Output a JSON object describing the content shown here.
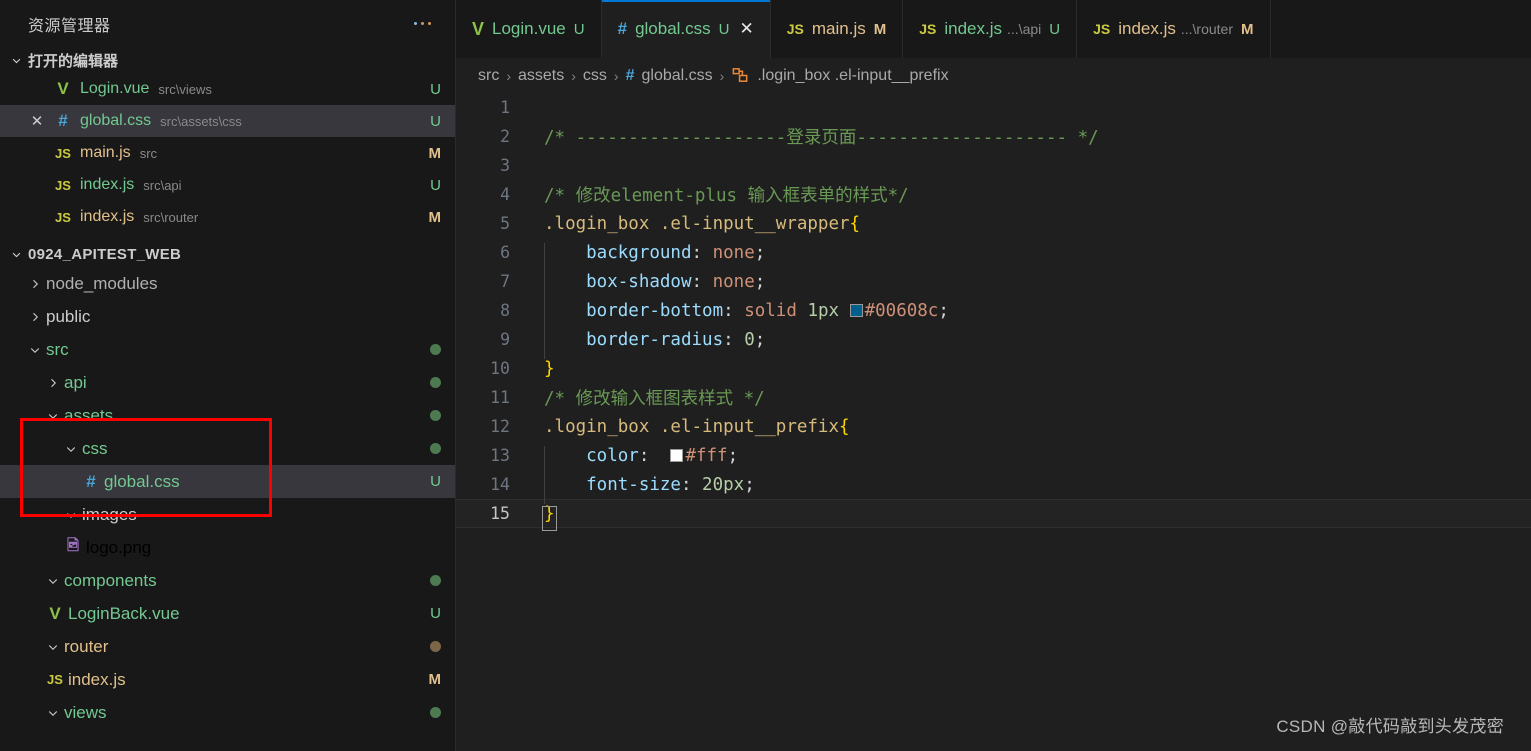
{
  "sidebar": {
    "title": "资源管理器",
    "more_icon": "ellipsis-icon",
    "open_editors": {
      "label": "打开的编辑器",
      "items": [
        {
          "icon": "vue-file-icon",
          "name": "Login.vue",
          "path": "src\\views",
          "badge": "U",
          "selected": false,
          "closable": false
        },
        {
          "icon": "css-file-icon",
          "name": "global.css",
          "path": "src\\assets\\css",
          "badge": "U",
          "selected": true,
          "closable": true
        },
        {
          "icon": "js-file-icon",
          "name": "main.js",
          "path": "src",
          "badge": "M",
          "selected": false,
          "closable": false
        },
        {
          "icon": "js-file-icon",
          "name": "index.js",
          "path": "src\\api",
          "badge": "U",
          "selected": false,
          "closable": false
        },
        {
          "icon": "js-file-icon",
          "name": "index.js",
          "path": "src\\router",
          "badge": "M",
          "selected": false,
          "closable": false
        }
      ]
    },
    "project": {
      "name": "0924_APITEST_WEB",
      "tree": [
        {
          "label": "node_modules",
          "type": "folder",
          "expanded": false,
          "indent": 1,
          "color": "dim",
          "badge": "",
          "dot": ""
        },
        {
          "label": "public",
          "type": "folder",
          "expanded": false,
          "indent": 1,
          "color": "gray",
          "badge": "",
          "dot": ""
        },
        {
          "label": "src",
          "type": "folder",
          "expanded": true,
          "indent": 1,
          "color": "green",
          "badge": "",
          "dot": "green"
        },
        {
          "label": "api",
          "type": "folder",
          "expanded": false,
          "indent": 2,
          "color": "green",
          "badge": "",
          "dot": "green"
        },
        {
          "label": "assets",
          "type": "folder",
          "expanded": true,
          "indent": 2,
          "color": "green",
          "badge": "",
          "dot": "green"
        },
        {
          "label": "css",
          "type": "folder",
          "expanded": true,
          "indent": 3,
          "color": "green",
          "badge": "",
          "dot": "green"
        },
        {
          "label": "global.css",
          "type": "css",
          "expanded": null,
          "indent": 4,
          "color": "green",
          "badge": "U",
          "dot": "",
          "selected": true
        },
        {
          "label": "images",
          "type": "folder",
          "expanded": true,
          "indent": 3,
          "color": "gray",
          "badge": "",
          "dot": ""
        },
        {
          "label": "logo.png",
          "type": "png",
          "expanded": null,
          "indent": 3,
          "color": "white",
          "badge": "",
          "dot": ""
        },
        {
          "label": "components",
          "type": "folder",
          "expanded": true,
          "indent": 2,
          "color": "green",
          "badge": "",
          "dot": "green"
        },
        {
          "label": "LoginBack.vue",
          "type": "vue",
          "expanded": null,
          "indent": 2,
          "color": "green",
          "badge": "U",
          "dot": ""
        },
        {
          "label": "router",
          "type": "folder",
          "expanded": true,
          "indent": 2,
          "color": "orange",
          "badge": "",
          "dot": "tan"
        },
        {
          "label": "index.js",
          "type": "js",
          "expanded": null,
          "indent": 2,
          "color": "orange",
          "badge": "M",
          "dot": ""
        },
        {
          "label": "views",
          "type": "folder",
          "expanded": true,
          "indent": 2,
          "color": "green",
          "badge": "",
          "dot": "green"
        }
      ]
    },
    "annotation": {
      "name": "red-highlight-box",
      "color": "#fe0000"
    }
  },
  "tabs": [
    {
      "icon": "vue-file-icon",
      "label": "Login.vue",
      "dir": "",
      "badge": "U",
      "active": false,
      "closable": false
    },
    {
      "icon": "css-file-icon",
      "label": "global.css",
      "dir": "",
      "badge": "U",
      "active": true,
      "closable": true
    },
    {
      "icon": "js-file-icon",
      "label": "main.js",
      "dir": "",
      "badge": "M",
      "active": false,
      "closable": false
    },
    {
      "icon": "js-file-icon",
      "label": "index.js",
      "dir": "...\\api",
      "badge": "U",
      "active": false,
      "closable": false
    },
    {
      "icon": "js-file-icon",
      "label": "index.js",
      "dir": "...\\router",
      "badge": "M",
      "active": false,
      "closable": false
    }
  ],
  "breadcrumb": {
    "items": [
      "src",
      "assets",
      "css",
      "global.css",
      ".login_box .el-input__prefix"
    ],
    "separator": "›",
    "file_icon": "#",
    "symbol_icon": "css-rule-symbol-icon"
  },
  "code": {
    "language": "css",
    "lines": [
      {
        "n": "1",
        "segments": []
      },
      {
        "n": "2",
        "segments": [
          {
            "t": "comment",
            "v": "/* --------------------登录页面-------------------- */"
          }
        ]
      },
      {
        "n": "3",
        "segments": []
      },
      {
        "n": "4",
        "segments": [
          {
            "t": "comment",
            "v": "/* 修改element-plus 输入框表单的样式*/"
          }
        ]
      },
      {
        "n": "5",
        "segments": [
          {
            "t": "sel",
            "v": ".login_box .el-input__wrapper"
          },
          {
            "t": "brace",
            "v": "{"
          }
        ]
      },
      {
        "n": "6",
        "segments": [
          {
            "t": "prop",
            "v": "    background"
          },
          {
            "t": "punct",
            "v": ": "
          },
          {
            "t": "val",
            "v": "none"
          },
          {
            "t": "punct",
            "v": ";"
          }
        ]
      },
      {
        "n": "7",
        "segments": [
          {
            "t": "prop",
            "v": "    box-shadow"
          },
          {
            "t": "punct",
            "v": ": "
          },
          {
            "t": "val",
            "v": "none"
          },
          {
            "t": "punct",
            "v": ";"
          }
        ]
      },
      {
        "n": "8",
        "segments": [
          {
            "t": "prop",
            "v": "    border-bottom"
          },
          {
            "t": "punct",
            "v": ": "
          },
          {
            "t": "val",
            "v": "solid"
          },
          {
            "t": "punct",
            "v": " "
          },
          {
            "t": "num",
            "v": "1px"
          },
          {
            "t": "punct",
            "v": " "
          },
          {
            "t": "swatch",
            "v": "#00608c"
          },
          {
            "t": "val",
            "v": "#00608c"
          },
          {
            "t": "punct",
            "v": ";"
          }
        ]
      },
      {
        "n": "9",
        "segments": [
          {
            "t": "prop",
            "v": "    border-radius"
          },
          {
            "t": "punct",
            "v": ": "
          },
          {
            "t": "num",
            "v": "0"
          },
          {
            "t": "punct",
            "v": ";"
          }
        ]
      },
      {
        "n": "10",
        "segments": [
          {
            "t": "brace",
            "v": "}"
          }
        ]
      },
      {
        "n": "11",
        "segments": [
          {
            "t": "comment",
            "v": "/* 修改输入框图表样式 */"
          }
        ]
      },
      {
        "n": "12",
        "segments": [
          {
            "t": "sel",
            "v": ".login_box .el-input__prefix"
          },
          {
            "t": "brace",
            "v": "{"
          }
        ]
      },
      {
        "n": "13",
        "segments": [
          {
            "t": "prop",
            "v": "    color"
          },
          {
            "t": "punct",
            "v": ":  "
          },
          {
            "t": "swatch",
            "v": "#ffffff"
          },
          {
            "t": "val",
            "v": "#fff"
          },
          {
            "t": "punct",
            "v": ";"
          }
        ]
      },
      {
        "n": "14",
        "segments": [
          {
            "t": "prop",
            "v": "    font-size"
          },
          {
            "t": "punct",
            "v": ": "
          },
          {
            "t": "num",
            "v": "20px"
          },
          {
            "t": "punct",
            "v": ";"
          }
        ]
      },
      {
        "n": "15",
        "segments": [
          {
            "t": "brace",
            "v": "}"
          }
        ],
        "current": true,
        "cursor": true
      }
    ]
  },
  "watermark": "CSDN @敲代码敲到头发茂密",
  "colors": {
    "accent": "#0078d4",
    "sidebar_bg": "#181818",
    "editor_bg": "#1f1f1f",
    "selection": "#37373d",
    "annotation": "#fe0000",
    "untracked": "#73c991",
    "modified": "#e2c08d"
  }
}
